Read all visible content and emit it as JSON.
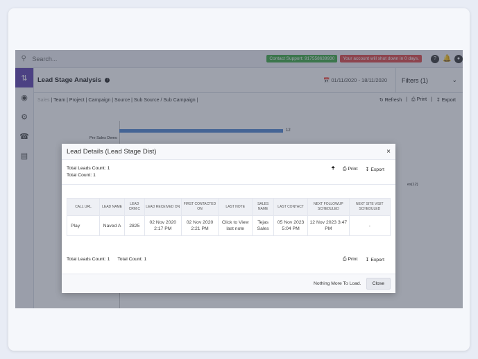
{
  "topbar": {
    "search_placeholder": "Search...",
    "support_badge": "Contact Support: 917558639930",
    "alert_badge": "Your account will shut down in 0 days.",
    "support_color": "#4caf50",
    "alert_color": "#e05555"
  },
  "sidebar": {
    "items": [
      {
        "icon": "sort-icon",
        "active": true
      },
      {
        "icon": "dashboard-icon"
      },
      {
        "icon": "settings-icon"
      },
      {
        "icon": "phone-icon"
      },
      {
        "icon": "money-icon"
      }
    ],
    "accent": "#6b4fb5"
  },
  "header": {
    "title": "Lead Stage Analysis",
    "date_range": "01/11/2020 - 18/11/2020",
    "filters_label": "Filters (1)"
  },
  "subnav": {
    "first": "Sales",
    "crumbs": "| Team | Project | Campaign | Source | Sub Source / Sub Campaign |",
    "refresh": "Refresh",
    "print": "Print",
    "export": "Export"
  },
  "chart": {
    "label": "Pre Sales Demo",
    "value": "12",
    "right_label": "es(12)"
  },
  "modal": {
    "title": "Lead Details (Lead Stage Dist)",
    "total_leads": "Total Leads Count: 1",
    "total_count": "Total Count: 1",
    "print": "Print",
    "export": "Export",
    "columns": [
      "Call URL",
      "Lead Name",
      "Lead CRM.C",
      "Lead Received On",
      "First Contacted On",
      "Last Note",
      "Sales Name",
      "Last Contact",
      "Next Followup Scheduled",
      "Next Site Visit Scheduled"
    ],
    "rows": [
      [
        "Play",
        "Naved A",
        "2825",
        "02 Nov 2020 2:17 PM",
        "02 Nov 2020 2:21 PM",
        "Click to View last note",
        "Tejas Sales",
        "05 Nov 2023 5:04 PM",
        "12 Nov 2023 3:47 PM",
        "-"
      ]
    ],
    "foot_total_leads": "Total Leads Count: 1",
    "foot_total_count": "Total Count: 1",
    "nothing_more": "Nothing More To Load.",
    "close_label": "Close"
  }
}
